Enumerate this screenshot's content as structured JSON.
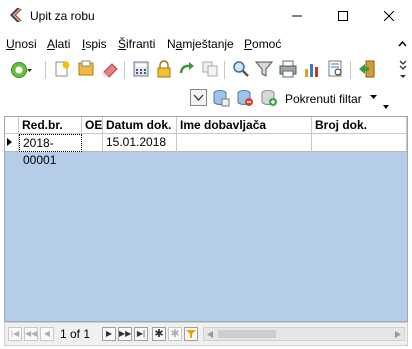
{
  "window": {
    "title": "Upit za robu"
  },
  "menu": [
    "Unosi",
    "Alati",
    "Ispis",
    "Šifranti",
    "Namještanje",
    "Pomoć"
  ],
  "toolbar2": {
    "filter_label": "Pokrenuti filtar"
  },
  "grid": {
    "columns": [
      "Red.br.",
      "OE",
      "Datum dok.",
      "Ime dobavljača",
      "Broj dok."
    ],
    "rows": [
      [
        "2018-00001",
        "",
        "15.01.2018",
        "",
        ""
      ]
    ]
  },
  "navigator": {
    "page_info": "1 of 1"
  }
}
